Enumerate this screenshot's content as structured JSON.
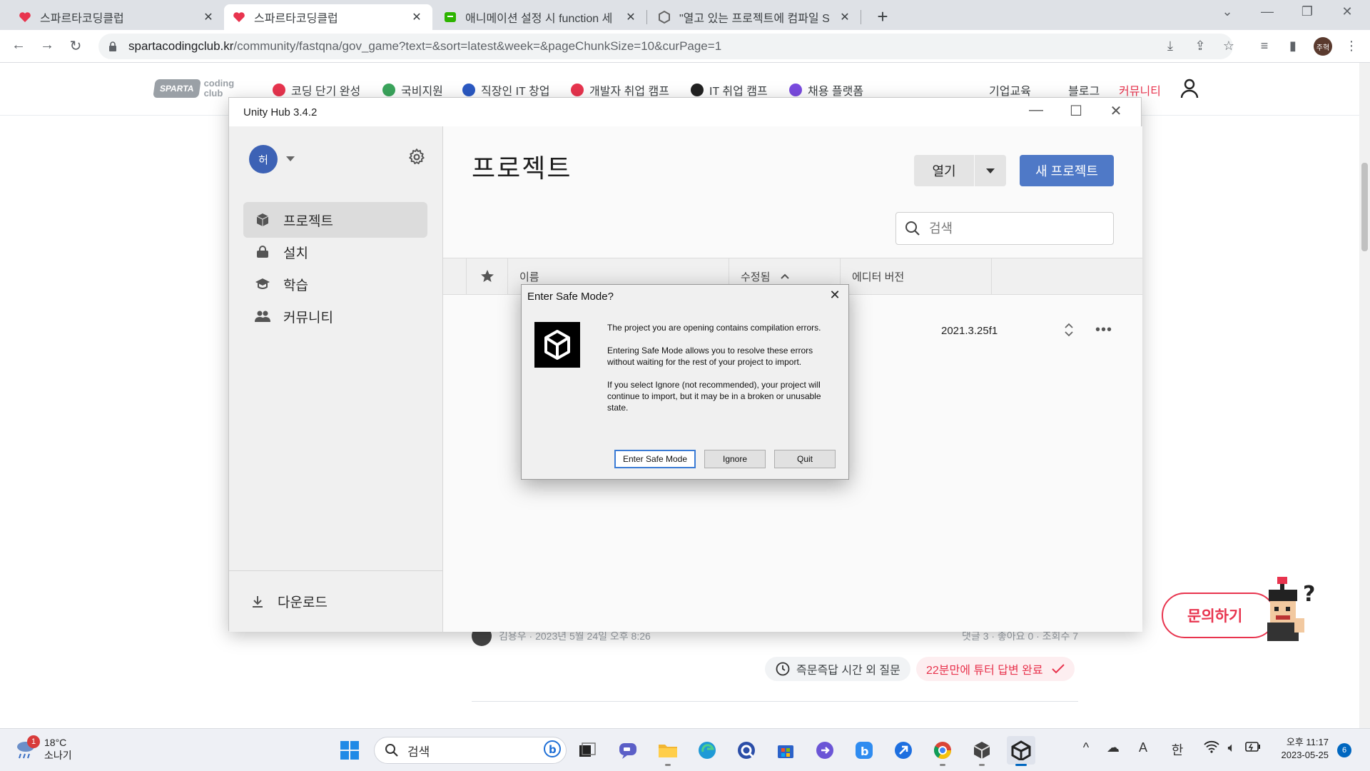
{
  "browser": {
    "tabs": [
      {
        "title": "스파르타코딩클럽",
        "close": "✕"
      },
      {
        "title": "스파르타코딩클럽",
        "close": "✕"
      },
      {
        "title": "애니메이션 설정 시 function 세",
        "close": "✕"
      },
      {
        "title": "\"열고 있는 프로젝트에 컴파일 S",
        "close": "✕"
      }
    ],
    "new_tab": "+",
    "url_host": "spartacodingclub.kr",
    "url_path": "/community/fastqna/gov_game?text=&sort=latest&week=&pageChunkSize=10&curPage=1",
    "profile_initials": "주혁"
  },
  "site": {
    "logo_badge": "SPARTA",
    "logo_sub1": "coding",
    "logo_sub2": "club",
    "nav": [
      {
        "label": "코딩 단기 완성",
        "color": "#e8344e"
      },
      {
        "label": "국비지원",
        "color": "#3aa55c"
      },
      {
        "label": "직장인 IT 창업",
        "color": "#2b59c3"
      },
      {
        "label": "개발자 취업 캠프",
        "color": "#e8344e"
      },
      {
        "label": "IT 취업 캠프",
        "color": "#222222"
      },
      {
        "label": "채용 플랫폼",
        "color": "#7a4be0"
      }
    ],
    "right_links": [
      "기업교육",
      "블로그",
      "커뮤니티"
    ],
    "post_author": "김용우 · 2023년 5월 24일 오후 8:26",
    "post_stats": "댓글 3 · 좋아요 0 · 조회수 7",
    "chip_outside": "즉문즉답 시간 외 질문",
    "chip_answered": "22분만에 튜터 답변 완료",
    "inquiry": "문의하기"
  },
  "hub": {
    "window_title": "Unity Hub 3.4.2",
    "avatar": "허",
    "sidebar": [
      {
        "label": "프로젝트",
        "icon": "cube-icon"
      },
      {
        "label": "설치",
        "icon": "lock-icon"
      },
      {
        "label": "학습",
        "icon": "graduation-cap-icon"
      },
      {
        "label": "커뮤니티",
        "icon": "people-icon"
      }
    ],
    "download": "다운로드",
    "title": "프로젝트",
    "open_label": "열기",
    "new_project_label": "새 프로젝트",
    "search_placeholder": "검색",
    "columns": {
      "name": "이름",
      "modified": "수정됨",
      "editor": "에디터 버전"
    },
    "row": {
      "editor_version": "2021.3.25f1"
    }
  },
  "dialog": {
    "title": "Enter Safe Mode?",
    "p1": "The project you are opening contains compilation errors.",
    "p2": "Entering Safe Mode allows you to resolve these errors without waiting for the rest of your project to import.",
    "p3": "If you select Ignore (not recommended), your project will continue to import, but it may be in a broken or unusable state.",
    "btn_safe": "Enter Safe Mode",
    "btn_ignore": "Ignore",
    "btn_quit": "Quit"
  },
  "taskbar": {
    "weather_badge": "1",
    "temp": "18°C",
    "condition": "소나기",
    "search": "검색",
    "ime_a": "A",
    "ime_lang": "한",
    "time": "오후 11:17",
    "date": "2023-05-25",
    "notifications": "6"
  }
}
